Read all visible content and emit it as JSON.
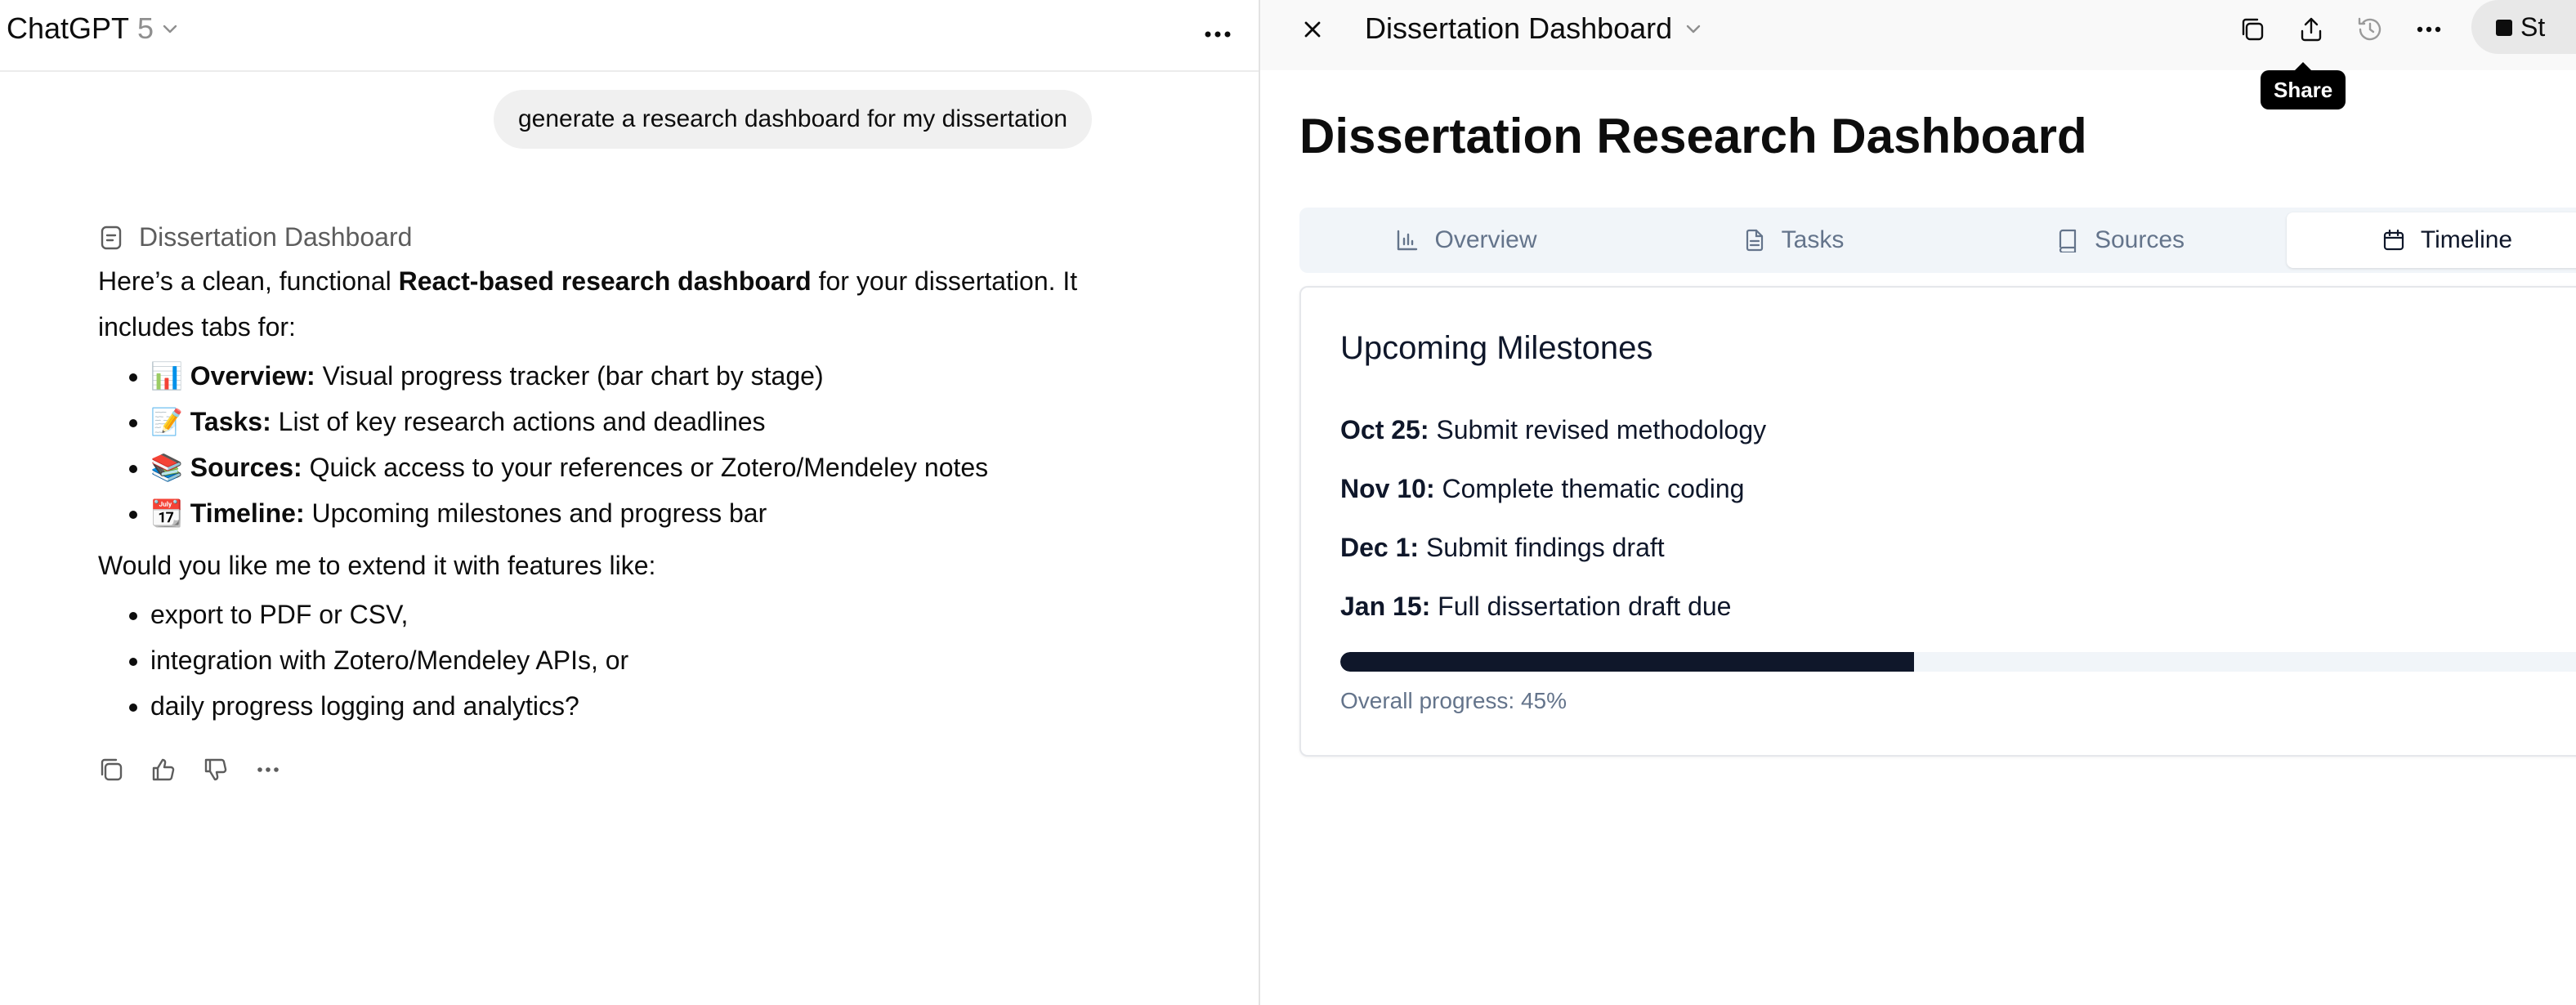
{
  "left_header": {
    "app_name": "ChatGPT",
    "model_version": "5"
  },
  "conversation": {
    "user_message": "generate a research dashboard for my dissertation",
    "canvas_reference": "Dissertation Dashboard",
    "intro_part1": "Here’s a clean, functional ",
    "intro_bold": "React-based research dashboard",
    "intro_part2": " for your dissertation. It includes tabs for:",
    "features": [
      {
        "emoji": "📊",
        "label": "Overview:",
        "text": " Visual progress tracker (bar chart by stage)"
      },
      {
        "emoji": "📝",
        "label": "Tasks:",
        "text": " List of key research actions and deadlines"
      },
      {
        "emoji": "📚",
        "label": "Sources:",
        "text": " Quick access to your references or Zotero/Mendeley notes"
      },
      {
        "emoji": "📆",
        "label": "Timeline:",
        "text": " Upcoming milestones and progress bar"
      }
    ],
    "question": "Would you like me to extend it with features like:",
    "suggestions": [
      "export to PDF or CSV,",
      "integration with Zotero/Mendeley APIs, or",
      "daily progress logging and analytics?"
    ]
  },
  "canvas_header": {
    "title": "Dissertation Dashboard",
    "tooltip": "Share",
    "stop_label": "St"
  },
  "dashboard": {
    "title": "Dissertation Research Dashboard",
    "tabs": [
      {
        "label": "Overview",
        "icon": "bar-chart-icon",
        "active": false
      },
      {
        "label": "Tasks",
        "icon": "file-text-icon",
        "active": false
      },
      {
        "label": "Sources",
        "icon": "book-icon",
        "active": false
      },
      {
        "label": "Timeline",
        "icon": "calendar-icon",
        "active": true
      }
    ],
    "card_title": "Upcoming Milestones",
    "milestones": [
      {
        "date": "Oct 25:",
        "task": " Submit revised methodology"
      },
      {
        "date": "Nov 10:",
        "task": " Complete thematic coding"
      },
      {
        "date": "Dec 1:",
        "task": " Submit findings draft"
      },
      {
        "date": "Jan 15:",
        "task": " Full dissertation draft due"
      }
    ],
    "progress_value": 0.45,
    "progress_text": "Overall progress: 45%"
  },
  "colors": {
    "progress_fill": "#0f172a",
    "progress_track": "#f1f5f9",
    "tab_bar_bg": "#f1f5f9",
    "muted_text": "#64748b"
  }
}
